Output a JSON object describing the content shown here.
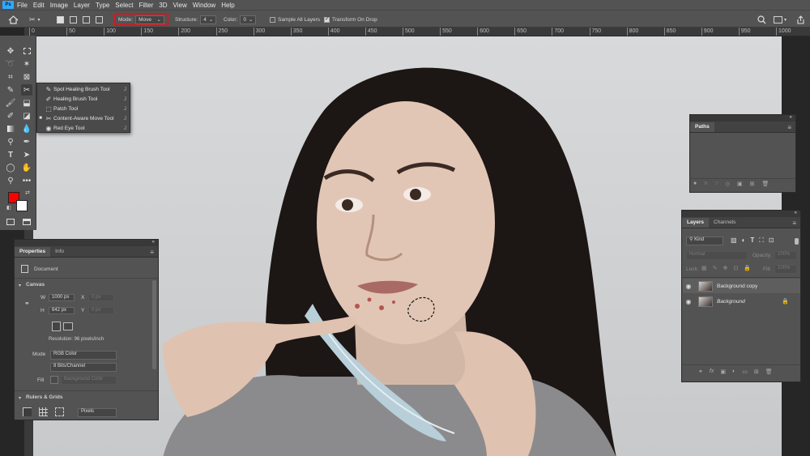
{
  "menu": [
    "File",
    "Edit",
    "Image",
    "Layer",
    "Type",
    "Select",
    "Filter",
    "3D",
    "View",
    "Window",
    "Help"
  ],
  "app_logo": "Ps",
  "options": {
    "mode_label": "Mode:",
    "mode_value": "Move",
    "structure_label": "Structure:",
    "structure_value": "4",
    "color_label": "Color:",
    "color_value": "0",
    "sample_all_layers": "Sample All Layers",
    "transform_on_drop": "Transform On Drop",
    "highlight_color": "#e0121b"
  },
  "ruler_ticks": [
    "0",
    "50",
    "100",
    "150",
    "200",
    "250",
    "300",
    "350",
    "400",
    "450",
    "500",
    "550",
    "600",
    "650",
    "700",
    "750",
    "800",
    "850",
    "900",
    "950",
    "1000"
  ],
  "flyout": {
    "items": [
      {
        "label": "Spot Healing Brush Tool",
        "key": "J",
        "selected": false
      },
      {
        "label": "Healing Brush Tool",
        "key": "J",
        "selected": false
      },
      {
        "label": "Patch Tool",
        "key": "J",
        "selected": false
      },
      {
        "label": "Content-Aware Move Tool",
        "key": "J",
        "selected": true
      },
      {
        "label": "Red Eye Tool",
        "key": "J",
        "selected": false
      }
    ]
  },
  "toolbar": {
    "foreground_color": "#ff0000",
    "background_color": "#ffffff"
  },
  "properties": {
    "tabs": [
      "Properties",
      "Info"
    ],
    "doc_label": "Document",
    "canvas_section": "Canvas",
    "w_label": "W",
    "w_value": "1000 px",
    "h_label": "H",
    "h_value": "642 px",
    "x_label": "X",
    "x_value": "0 px",
    "y_label": "Y",
    "y_value": "0 px",
    "resolution": "Resolution: 96 pixels/inch",
    "mode_label": "Mode",
    "mode_value": "RGB Color",
    "bits_value": "8 Bits/Channel",
    "fill_label": "Fill",
    "fill_value": "Background Color",
    "rulers_section": "Rulers & Grids",
    "units_value": "Pixels"
  },
  "paths": {
    "tab": "Paths"
  },
  "layers": {
    "tabs": [
      "Layers",
      "Channels"
    ],
    "kind_label": "Kind",
    "blend_mode": "Normal",
    "opacity_label": "Opacity:",
    "opacity_value": "100%",
    "lock_label": "Lock:",
    "fill_label": "Fill:",
    "fill_value": "100%",
    "items": [
      {
        "name": "Background copy",
        "italic": false
      },
      {
        "name": "Background",
        "italic": true
      }
    ]
  }
}
